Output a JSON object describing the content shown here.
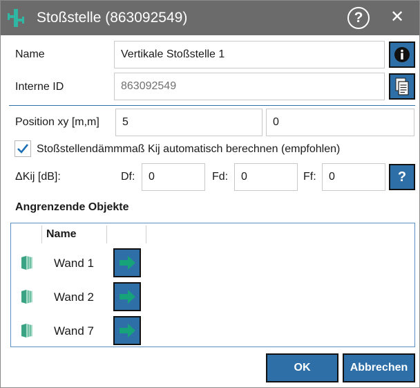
{
  "window": {
    "title": "Stoßstelle (863092549)",
    "help_glyph": "?",
    "close_glyph": "✕",
    "titlebar_color": "#6b6b6b"
  },
  "form": {
    "name_label": "Name",
    "name_value": "Vertikale Stoßstelle 1",
    "internal_id_label": "Interne ID",
    "internal_id_value": "863092549",
    "position_label": "Position xy [m,m]",
    "position_x": "5",
    "position_y": "0",
    "auto_calc_label": "Stoßstellendämmmaß Kij automatisch berechnen (empfohlen)",
    "auto_calc_checked": true,
    "delta_kij_label": "ΔKij [dB]:",
    "df_label": "Df:",
    "df_value": "0",
    "fd_label": "Fd:",
    "fd_value": "0",
    "ff_label": "Ff:",
    "ff_value": "0",
    "kij_help_glyph": "?"
  },
  "adjacent": {
    "section_title": "Angrenzende Objekte",
    "column_name": "Name",
    "rows": [
      {
        "name": "Wand 1",
        "icon": "wall-icon",
        "action_icon": "arrow-right-icon"
      },
      {
        "name": "Wand 2",
        "icon": "wall-icon",
        "action_icon": "arrow-right-icon"
      },
      {
        "name": "Wand 7",
        "icon": "wall-icon",
        "action_icon": "arrow-right-icon"
      }
    ]
  },
  "buttons": {
    "ok": "OK",
    "cancel": "Abbrechen"
  },
  "colors": {
    "accent_button": "#2f6fa8",
    "arrow_green": "#16a37a",
    "wall_green": "#3aa383"
  }
}
